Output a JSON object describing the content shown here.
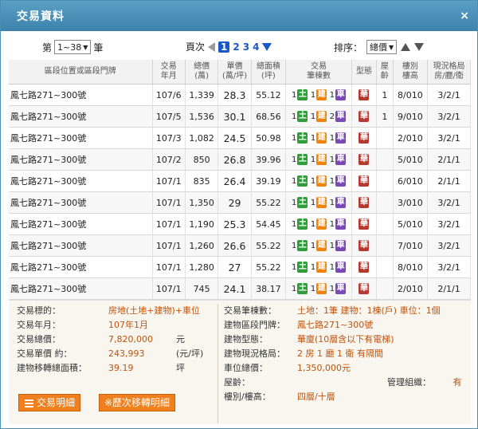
{
  "title": "交易資料",
  "close_glyph": "×",
  "controls": {
    "batch_prefix": "第",
    "batch_value": "1~38",
    "batch_suffix": "筆",
    "page_label": "頁次",
    "current_page": "1",
    "pages": [
      "2",
      "3",
      "4"
    ],
    "sort_label": "排序：",
    "sort_value": "總價"
  },
  "headers": [
    "區段位置或區段門牌",
    "交易\n年月",
    "總價\n(萬)",
    "單價\n(萬/坪)",
    "總面積\n(坪)",
    "交易\n筆棟數",
    "型態",
    "屋\n齡",
    "樓別\n樓高",
    "現況格局\n房/廳/衛"
  ],
  "rows": [
    {
      "addr": "鳳七路271~300號",
      "ym": "107/6",
      "total": "1,339",
      "unit": "28.3",
      "area": "55.12",
      "land": "1",
      "bldg": "1",
      "car": "1",
      "type": "華",
      "age": "1",
      "floor": "8/010",
      "layout": "3/2/1"
    },
    {
      "addr": "鳳七路271~300號",
      "ym": "107/5",
      "total": "1,536",
      "unit": "30.1",
      "area": "68.56",
      "land": "1",
      "bldg": "1",
      "car": "2",
      "type": "華",
      "age": "1",
      "floor": "9/010",
      "layout": "3/2/1"
    },
    {
      "addr": "鳳七路271~300號",
      "ym": "107/3",
      "total": "1,082",
      "unit": "24.5",
      "area": "50.98",
      "land": "1",
      "bldg": "1",
      "car": "1",
      "type": "華",
      "age": "",
      "floor": "2/010",
      "layout": "3/2/1"
    },
    {
      "addr": "鳳七路271~300號",
      "ym": "107/2",
      "total": "850",
      "unit": "26.8",
      "area": "39.96",
      "land": "1",
      "bldg": "1",
      "car": "1",
      "type": "華",
      "age": "",
      "floor": "5/010",
      "layout": "2/1/1"
    },
    {
      "addr": "鳳七路271~300號",
      "ym": "107/1",
      "total": "835",
      "unit": "26.4",
      "area": "39.19",
      "land": "1",
      "bldg": "1",
      "car": "1",
      "type": "華",
      "age": "",
      "floor": "6/010",
      "layout": "2/1/1"
    },
    {
      "addr": "鳳七路271~300號",
      "ym": "107/1",
      "total": "1,350",
      "unit": "29",
      "area": "55.22",
      "land": "1",
      "bldg": "1",
      "car": "1",
      "type": "華",
      "age": "",
      "floor": "3/010",
      "layout": "3/2/1"
    },
    {
      "addr": "鳳七路271~300號",
      "ym": "107/1",
      "total": "1,190",
      "unit": "25.3",
      "area": "54.45",
      "land": "1",
      "bldg": "1",
      "car": "1",
      "type": "華",
      "age": "",
      "floor": "5/010",
      "layout": "3/2/1"
    },
    {
      "addr": "鳳七路271~300號",
      "ym": "107/1",
      "total": "1,260",
      "unit": "26.6",
      "area": "55.22",
      "land": "1",
      "bldg": "1",
      "car": "1",
      "type": "華",
      "age": "",
      "floor": "7/010",
      "layout": "3/2/1"
    },
    {
      "addr": "鳳七路271~300號",
      "ym": "107/1",
      "total": "1,280",
      "unit": "27",
      "area": "55.22",
      "land": "1",
      "bldg": "1",
      "car": "1",
      "type": "華",
      "age": "",
      "floor": "8/010",
      "layout": "3/2/1"
    },
    {
      "addr": "鳳七路271~300號",
      "ym": "107/1",
      "total": "745",
      "unit": "24.1",
      "area": "38.17",
      "land": "1",
      "bldg": "1",
      "car": "1",
      "type": "華",
      "age": "",
      "floor": "2/010",
      "layout": "2/1/1"
    }
  ],
  "badges": {
    "land": "土",
    "bldg": "建",
    "car": "車"
  },
  "detail": {
    "left": [
      {
        "label": "交易標的：",
        "value": "房地(土地+建物)+車位",
        "unit": ""
      },
      {
        "label": "交易年月：",
        "value": "107年1月",
        "unit": ""
      },
      {
        "label": "交易總價：",
        "value": "7,820,000",
        "unit": "元"
      },
      {
        "label": "交易單價 約：",
        "value": "243,993",
        "unit": "(元/坪)"
      },
      {
        "label": "建物移轉總面積：",
        "value": "39.19",
        "unit": "坪"
      }
    ],
    "right": [
      {
        "label": "交易筆棟數：",
        "value": "土地：1筆 建物：1棟(戶) 車位：1個"
      },
      {
        "label": "建物區段門牌：",
        "value": "鳳七路271~300號"
      },
      {
        "label": "建物型態：",
        "value": "華廈(10層含以下有電梯)"
      },
      {
        "label": "建物現況格局：",
        "value": "2 房 1 廳 1 衛 有隔間"
      },
      {
        "label": "車位總價：",
        "value": "1,350,000元"
      },
      {
        "label": "屋齡：",
        "value": ""
      },
      {
        "label": "樓別/樓高：",
        "value": "四層/十層"
      }
    ],
    "mgmt_label": "管理組織：",
    "mgmt_value": "有"
  },
  "buttons": {
    "detail": "交易明細",
    "history": "※歷次移轉明細"
  },
  "colors": {
    "title_bar": "#4a90ba",
    "value_text": "#c0520b",
    "badge_land": "#2e9d3a",
    "badge_bldg": "#f0840a",
    "badge_car": "#7b49b6",
    "badge_type": "#b43a30",
    "button": "#f0801e"
  }
}
